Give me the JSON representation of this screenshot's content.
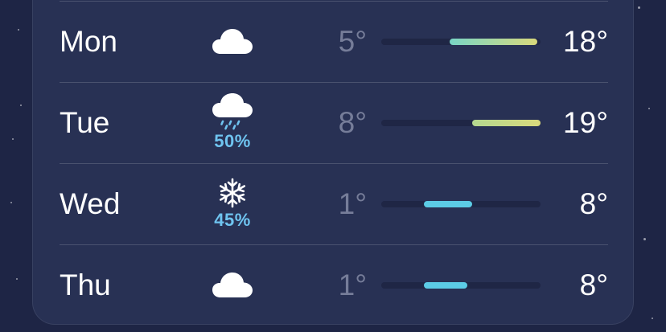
{
  "forecast": [
    {
      "day": "Mon",
      "icon": "cloud-icon",
      "precip": "",
      "low": "5°",
      "high": "18°",
      "bar_start": 0.43,
      "bar_end": 0.98,
      "bar_colors": [
        "#79d6c6",
        "#d9d97c"
      ]
    },
    {
      "day": "Tue",
      "icon": "cloud-rain-icon",
      "precip": "50%",
      "low": "8°",
      "high": "19°",
      "bar_start": 0.57,
      "bar_end": 1.0,
      "bar_colors": [
        "#b4d890",
        "#d9d97c"
      ]
    },
    {
      "day": "Wed",
      "icon": "snowflake-icon",
      "precip": "45%",
      "low": "1°",
      "high": "8°",
      "bar_start": 0.27,
      "bar_end": 0.57,
      "bar_colors": [
        "#5ccce6",
        "#5ccce6"
      ]
    },
    {
      "day": "Thu",
      "icon": "cloud-icon",
      "precip": "",
      "low": "1°",
      "high": "8°",
      "bar_start": 0.27,
      "bar_end": 0.54,
      "bar_colors": [
        "#5ccce6",
        "#5ccce6"
      ]
    }
  ]
}
